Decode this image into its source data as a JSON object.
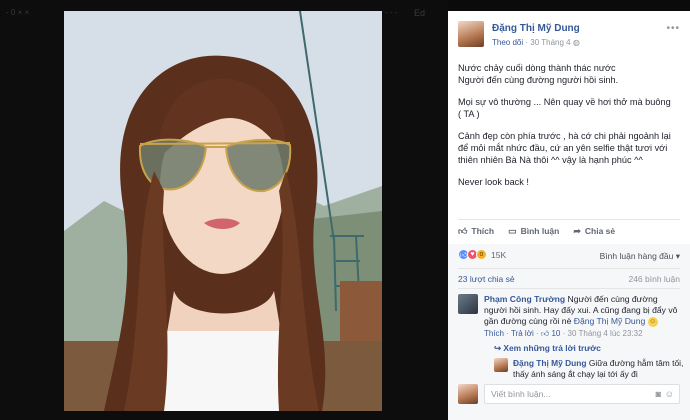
{
  "background": {
    "labels": [
      "- 0 × ×",
      "- - -",
      "Ed"
    ]
  },
  "post": {
    "author": "Đặng Thị Mỹ Dung",
    "follow": "Theo dõi",
    "date": "30 Tháng 4",
    "privacy_icon": "globe-icon",
    "text": [
      "Nước chảy cuối dòng thành thác nước\nNgười đến cùng đường người hồi sinh.",
      "Mọi sự vô thường ... Nên quay về hơi thở mà buông\n( TA )",
      "Cảnh đẹp còn phía trước , hà cớ chi phải ngoảnh lại để mỏi mắt nhức đầu, cứ an yên selfie thật tươi với thiên nhiên Bà Nà thôi ^^ vậy là hạnh phúc ^^",
      "Never look back !"
    ]
  },
  "actions": {
    "like": "Thích",
    "comment": "Bình luận",
    "share": "Chia sẻ"
  },
  "reactions": {
    "count": "15K",
    "sort": "Bình luận hàng đầu ▾"
  },
  "stats": {
    "shares": "23 lượt chia sẻ",
    "comments": "246 bình luận"
  },
  "comment": {
    "author": "Phạm Công Trường",
    "text": "Người đến cùng đường người hồi sinh. Hay đấy xui. A cũng đang bị đẩy vô gần đường cùng rồi nè",
    "mention": "Đặng Thị Mỹ Dung",
    "like": "Thích",
    "reply": "Trả lời",
    "likes": "10",
    "time": "30 Tháng 4 lúc 23:32",
    "view_replies": "Xem những trả lời trước"
  },
  "reply": {
    "author": "Đặng Thị Mỹ Dung",
    "text": "Giữa đường hẫm tâm tối, thấy ánh sáng ắt chạy lại tới ấy đi"
  },
  "composer": {
    "placeholder": "Viết bình luận..."
  },
  "colors": {
    "link": "#365899",
    "text": "#1d2129",
    "muted": "#90949c"
  }
}
